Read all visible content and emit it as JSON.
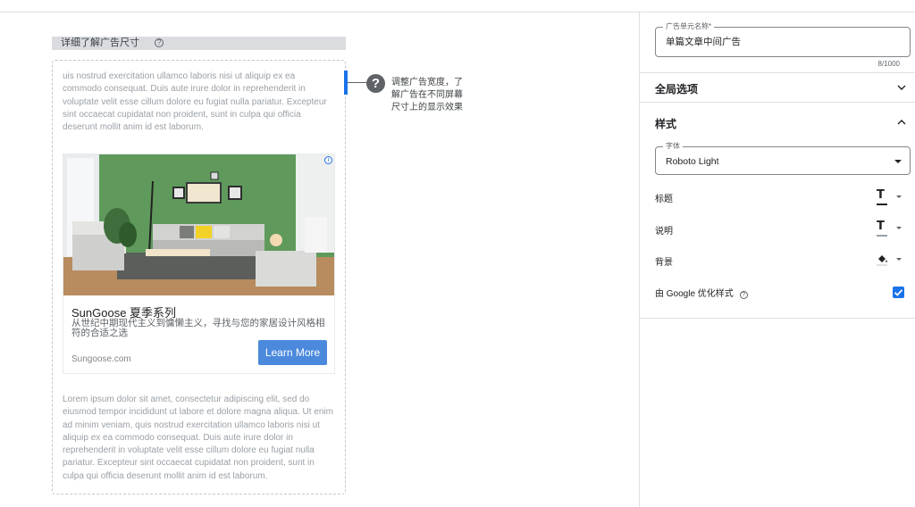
{
  "preview": {
    "learn_more_size": "详细了解广告尺寸",
    "help_icon_glyph": "?",
    "ipsum_top": "uis nostrud exercitation ullamco laboris nisi ut aliquip ex ea commodo consequat. Duis aute irure dolor in reprehenderit in voluptate velit esse cillum dolore eu fugiat nulla pariatur. Excepteur sint occaecat cupidatat non proident, sunt in culpa qui officia deserunt mollit anim id est laborum.",
    "ipsum_bottom": "Lorem ipsum dolor sit amet, consectetur adipiscing elit, sed do eiusmod tempor incididunt ut labore et dolore magna aliqua. Ut enim ad minim veniam, quis nostrud exercitation ullamco laboris nisi ut aliquip ex ea commodo consequat. Duis aute irure dolor in reprehenderit in voluptate velit esse cillum dolore eu fugiat nulla pariatur. Excepteur sint occaecat cupidatat non proident, sunt in culpa qui officia deserunt mollit anim id est laborum.",
    "resize_hint_icon": "?",
    "resize_hint": "调整广告宽度，了解广告在不同屏幕尺寸上的显示效果"
  },
  "ad": {
    "adchoices_glyph": "i",
    "title": "SunGoose 夏季系列",
    "description": "从世纪中期现代主义到慵懒主义，寻找与您的家居设计风格相符的合适之选",
    "domain": "Sungoose.com",
    "cta": "Learn More"
  },
  "panel": {
    "ad_unit_name_label": "广告单元名称*",
    "ad_unit_name_value": "单篇文章中间广告",
    "char_count": "8/1000",
    "global_options": "全局选项",
    "style_section": "样式",
    "font_label": "字体",
    "font_value": "Roboto Light",
    "rows": {
      "title_label": "标题",
      "description_label": "说明",
      "background_label": "背景",
      "optimize_label": "由 Google 优化样式",
      "t_glyph": "T",
      "help_glyph": "?"
    },
    "colors": {
      "accent": "#1a73e8",
      "title_color": "#202124",
      "description_color": "#5f6368"
    },
    "optimize_checked": true
  }
}
